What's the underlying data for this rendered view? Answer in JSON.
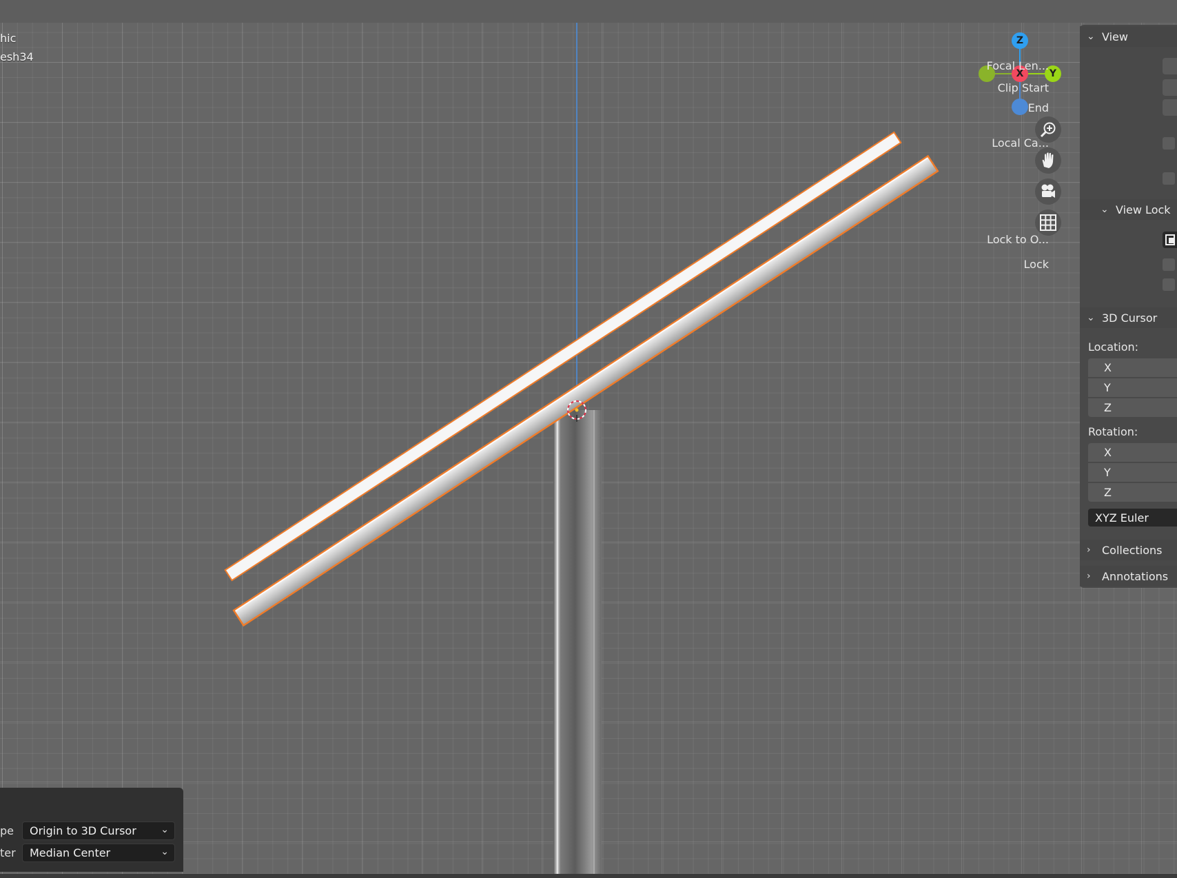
{
  "viewport": {
    "overlay_line1": "hic",
    "overlay_line2": "esh34"
  },
  "gizmo": {
    "axes": {
      "x": "X",
      "y": "Y",
      "z": "Z"
    },
    "colors": {
      "x": "#f2495f",
      "y": "#9ad617",
      "z": "#2f9ff0",
      "neg_y": "#8ab32a",
      "neg_z": "#4d8ad6"
    }
  },
  "nav_icons": [
    "zoom-icon",
    "pan-hand-icon",
    "camera-icon",
    "grid-icon"
  ],
  "sidebar": {
    "view": {
      "header": "View",
      "focal_length_label": "Focal Len...",
      "clip_start_label": "Clip Start",
      "clip_end_label": "End",
      "local_camera_label": "Local Ca..."
    },
    "view_lock": {
      "header": "View Lock",
      "lock_to_object_label": "Lock to O...",
      "lock_label": "Lock"
    },
    "cursor": {
      "header": "3D Cursor",
      "location_label": "Location:",
      "location_axes": [
        "X",
        "Y",
        "Z"
      ],
      "rotation_label": "Rotation:",
      "rotation_axes": [
        "X",
        "Y",
        "Z"
      ],
      "rotation_mode": "XYZ Euler"
    },
    "collections_header": "Collections",
    "annotations_header": "Annotations"
  },
  "operator_panel": {
    "type_label": "pe",
    "type_value": "Origin to 3D Cursor",
    "center_label": "ter",
    "center_value": "Median Center"
  },
  "colors": {
    "selection_outline": "#f07c2a",
    "viewport_bg": "#666666",
    "axis_line": "#4a8fe0"
  }
}
